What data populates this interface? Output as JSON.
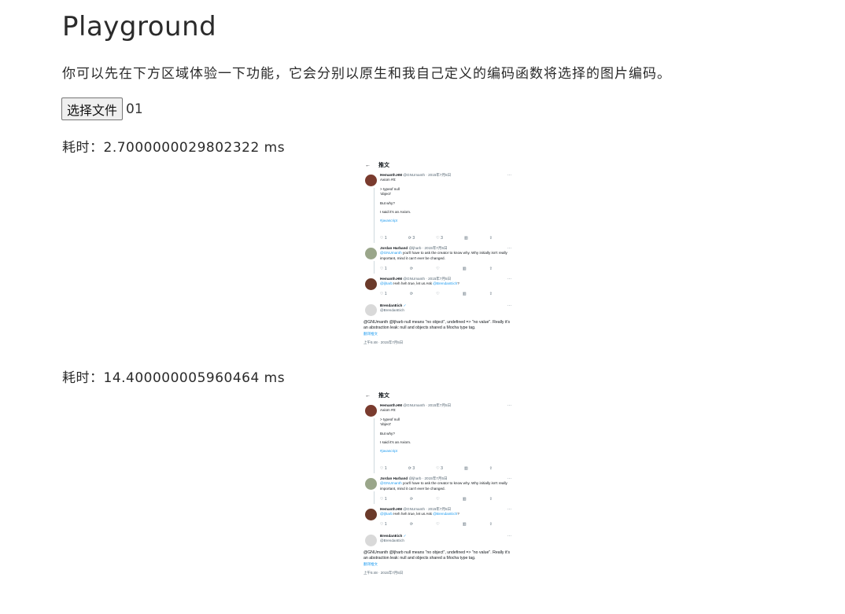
{
  "page": {
    "title": "Playground",
    "intro": "你可以先在下方区域体验一下功能，它会分别以原生和我自己定义的编码函数将选择的图片编码。",
    "file_button_label": "选择文件",
    "file_name": "01"
  },
  "results": [
    {
      "time_label": "耗时：2.7000000029802322 ms"
    },
    {
      "time_label": "耗时：14.400000005960464 ms"
    }
  ],
  "tweet_image": {
    "header_back": "←",
    "header_title": "推文",
    "t1_name": "Hemanth.HM",
    "t1_meta": "@GNUmanth · 2015年7月5日",
    "t1_text": "Axiom #0:",
    "t1_code1": "> typeof null",
    "t1_code2": "'object'",
    "t1_q": "But why?",
    "t1_said": "I said it's an Axiom.",
    "t1_tag": "#javascript",
    "t1_acts": [
      "♡ 1",
      "⟳ 3",
      "♡ 3",
      "▥",
      "⇪"
    ],
    "t2_name": "Jordan Harband",
    "t2_meta": "@ljharb · 2015年7月5日",
    "t2_mention": "@GNUmanth",
    "t2_text": " you'll have to ask the creator to know why. Why initially isn't really important, mind it can't ever be changed.",
    "t2_acts": [
      "♡ 1",
      "⟳",
      "♡",
      "▥",
      "⇪"
    ],
    "t3_name": "Hemanth.HM",
    "t3_meta": "@GNUmanth · 2015年7月5日",
    "t3_mention": "@ljharb",
    "t3_text": " Heh heh true, let us Ask ",
    "t3_mention2": "@BrendanEich",
    "t3_end": "?",
    "t3_acts": [
      "♡ 1",
      "⟳",
      "♡",
      "▥",
      "⇪"
    ],
    "t4_name": "BrendanEich",
    "t4_verified": "✓",
    "t4_handle": "@BrendanEich",
    "main_mentions": "@GNUmanth @ljharb",
    "main_text": " null means \"no object\", undefined => \"no value\". Really it's an abstraction leak: null and objects shared a Mocha type tag.",
    "translate": "翻译推文",
    "footer": "上午5:48 · 2015年7月5日",
    "more": "···"
  },
  "colors": {
    "link": "#1d9bf0",
    "meta": "#536471",
    "button_bg": "#efefef",
    "button_border": "#767676"
  }
}
